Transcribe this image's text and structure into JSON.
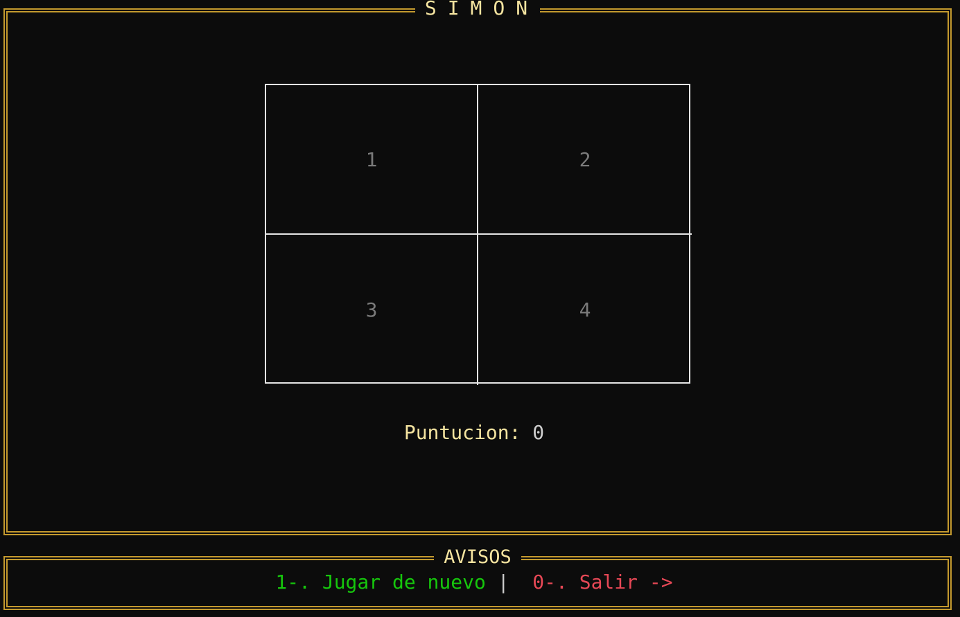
{
  "main": {
    "title": "SIMON",
    "cells": [
      "1",
      "2",
      "3",
      "4"
    ],
    "score_label": "Puntucion:",
    "score_value": "0"
  },
  "notices": {
    "title": "AVISOS",
    "play_again": "1-. Jugar de nuevo",
    "separator": "|",
    "exit": "0-. Salir ->"
  },
  "colors": {
    "frame": "#c49a2e",
    "title_text": "#f5e4a0",
    "grid_line": "#e6e6e6",
    "cell_number": "#7a7a7a",
    "play_option": "#16c60c",
    "exit_option": "#e74856",
    "background": "#0c0c0c"
  }
}
